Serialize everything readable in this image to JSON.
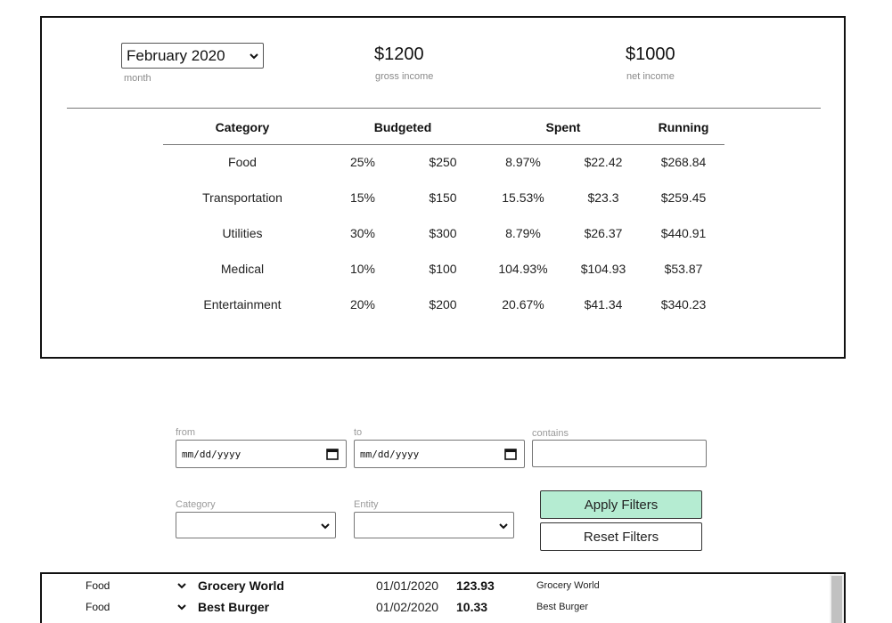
{
  "summary": {
    "month_value": "February 2020",
    "month_caption": "month",
    "gross_income": "$1200",
    "gross_caption": "gross income",
    "net_income": "$1000",
    "net_caption": "net income"
  },
  "budget_table": {
    "headers": {
      "category": "Category",
      "budgeted": "Budgeted",
      "spent": "Spent",
      "running": "Running"
    },
    "rows": [
      {
        "category": "Food",
        "budget_pct": "25%",
        "budget_amt": "$250",
        "spent_pct": "8.97%",
        "spent_amt": "$22.42",
        "running": "$268.84"
      },
      {
        "category": "Transportation",
        "budget_pct": "15%",
        "budget_amt": "$150",
        "spent_pct": "15.53%",
        "spent_amt": "$23.3",
        "running": "$259.45"
      },
      {
        "category": "Utilities",
        "budget_pct": "30%",
        "budget_amt": "$300",
        "spent_pct": "8.79%",
        "spent_amt": "$26.37",
        "running": "$440.91"
      },
      {
        "category": "Medical",
        "budget_pct": "10%",
        "budget_amt": "$100",
        "spent_pct": "104.93%",
        "spent_amt": "$104.93",
        "running": "$53.87"
      },
      {
        "category": "Entertainment",
        "budget_pct": "20%",
        "budget_amt": "$200",
        "spent_pct": "20.67%",
        "spent_amt": "$41.34",
        "running": "$340.23"
      }
    ]
  },
  "filters": {
    "from_label": "from",
    "from_placeholder": "mm/dd/yyyy",
    "to_label": "to",
    "to_placeholder": "mm/dd/yyyy",
    "contains_label": "contains",
    "contains_value": "",
    "category_label": "Category",
    "category_value": "",
    "entity_label": "Entity",
    "entity_value": "",
    "apply_label": "Apply Filters",
    "reset_label": "Reset Filters",
    "apply_color": "#b5ecd2"
  },
  "transactions": [
    {
      "category": "Food",
      "entity": "Grocery World",
      "date": "01/01/2020",
      "amount": "123.93",
      "note": "Grocery World"
    },
    {
      "category": "Food",
      "entity": "Best Burger",
      "date": "01/02/2020",
      "amount": "10.33",
      "note": "Best Burger"
    }
  ],
  "icons": {
    "select_chevron": "chevron-down-icon",
    "calendar": "calendar-icon"
  }
}
